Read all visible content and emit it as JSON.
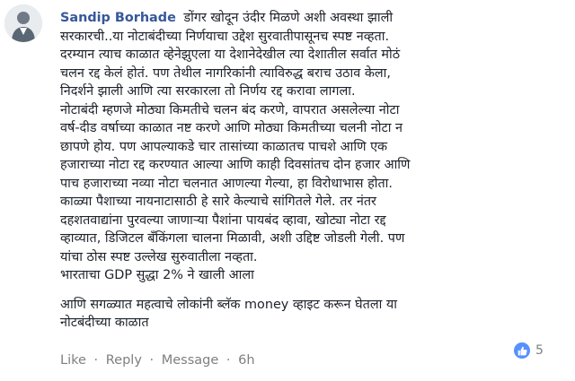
{
  "comment": {
    "author": "Sandip Borhade",
    "lines": [
      "डोंगर खोदून उंदीर मिळणे अशी अवस्था झाली",
      "सरकारची..या नोटाबंदीच्या निर्णयाचा उद्देश सुरवातीपासूनच स्पष्ट नव्हता.",
      "दरम्यान त्याच काळात व्हेनेझुएला या देशानेदेखील त्या देशातील सर्वात मोठं",
      "चलन रद्द केलं होतं. पण तेथील नागरिकांनी त्याविरुद्ध बराच उठाव केला,",
      "निदर्शने झाली आणि त्या सरकारला तो निर्णय रद्द करावा लागला.",
      "नोटाबंदी म्हणजे मोठ्या किमतीचे चलन बंद करणे, वापरात असलेल्या नोटा",
      "वर्ष-दीड वर्षाच्या काळात नष्ट करणे आणि मोठ्या किमतीच्या चलनी नोटा न",
      "छापणे होय. पण आपल्याकडे चार तासांच्या काळातच पाचशे आणि एक",
      "हजाराच्या नोटा रद्द करण्यात आल्या आणि काही दिवसांतच दोन हजार आणि",
      "पाच हजाराच्या नव्या नोटा चलनात आणल्या गेल्या, हा विरोधाभास होता.",
      "काळ्या पैशाच्या नायनाटासाठी हे सारे केल्याचे सांगितले गेले. तर नंतर",
      "दहशतवाद्यांना पुरवल्या जाणाऱ्या पैशांना पायबंद व्हावा, खोट्या नोटा रद्द",
      "व्हाव्यात, डिजिटल बँकिंगला चालना मिळावी, अशी उद्दिष्ट जोडली गेली. पण",
      "यांचा ठोस स्पष्ट उल्लेख सुरुवातीला नव्हता.",
      "भारताचा GDP सुद्धा 2% ने खाली आला"
    ],
    "second_paragraph": [
      "आणि सगळ्यात महत्वाचे लोकांनी ब्लॅक money व्हाइट करून घेतला या",
      "नोटबंदीच्या काळात"
    ]
  },
  "actions": {
    "like": "Like",
    "reply": "Reply",
    "message": "Message",
    "separator": "·",
    "time": "6h"
  },
  "reactions": {
    "count": "5",
    "icon": "thumbs-up-icon"
  },
  "colors": {
    "author": "#365899",
    "text": "#1d2129",
    "meta": "#7f7f7f",
    "like_badge": "#5890ff"
  }
}
